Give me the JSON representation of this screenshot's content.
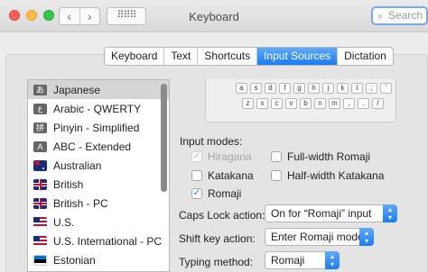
{
  "window": {
    "title": "Keyboard"
  },
  "toolbar": {
    "back_glyph": "‹",
    "forward_glyph": "›",
    "grid_glyph": "⠿⠿⠿"
  },
  "search": {
    "placeholder": "Search"
  },
  "tabs": [
    {
      "label": "Keyboard",
      "active": false
    },
    {
      "label": "Text",
      "active": false
    },
    {
      "label": "Shortcuts",
      "active": false
    },
    {
      "label": "Input Sources",
      "active": true
    },
    {
      "label": "Dictation",
      "active": false
    }
  ],
  "sources": [
    {
      "label": "Japanese",
      "icon": "japanese-hiragana-icon",
      "glyph": "あ",
      "selected": true
    },
    {
      "label": "Arabic - QWERTY",
      "icon": "arabic-icon",
      "glyph": "ع"
    },
    {
      "label": "Pinyin - Simplified",
      "icon": "pinyin-icon",
      "glyph": "拼"
    },
    {
      "label": "ABC - Extended",
      "icon": "abc-extended-icon",
      "glyph": "A"
    },
    {
      "label": "Australian",
      "icon": "australia-flag-icon"
    },
    {
      "label": "British",
      "icon": "uk-flag-icon"
    },
    {
      "label": "British - PC",
      "icon": "uk-flag-icon"
    },
    {
      "label": "U.S.",
      "icon": "us-flag-icon"
    },
    {
      "label": "U.S. International - PC",
      "icon": "us-flag-icon"
    },
    {
      "label": "Estonian",
      "icon": "estonia-flag-icon"
    }
  ],
  "keyboard": {
    "row1": [
      "a",
      "s",
      "d",
      "f",
      "g",
      "h",
      "j",
      "k",
      "l",
      ";",
      "'"
    ],
    "row2": [
      "z",
      "x",
      "c",
      "v",
      "b",
      "n",
      "m",
      ",",
      ".",
      "/"
    ]
  },
  "input_modes": {
    "label": "Input modes:",
    "options": [
      {
        "label": "Hiragana",
        "checked": true,
        "disabled": true
      },
      {
        "label": "Full-width Romaji",
        "checked": false
      },
      {
        "label": "Katakana",
        "checked": false
      },
      {
        "label": "Half-width Katakana",
        "checked": false
      },
      {
        "label": "Romaji",
        "checked": true
      }
    ]
  },
  "fields": {
    "caps_lock": {
      "label": "Caps Lock action:",
      "value": "On for “Romaji” input"
    },
    "shift_key": {
      "label": "Shift key action:",
      "value": "Enter Romaji mode"
    },
    "typing_method": {
      "label": "Typing method:",
      "value": "Romaji"
    }
  },
  "colors": {
    "accent": "#1a7cf5",
    "selected_row": "#d5d5d5"
  }
}
